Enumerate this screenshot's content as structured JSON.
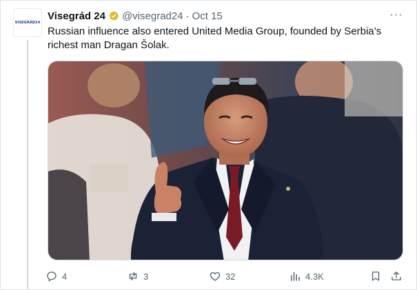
{
  "tweet": {
    "avatar_text": "VISEGRÁD24",
    "display_name": "Visegrád 24",
    "handle": "@visegrad24",
    "separator": "·",
    "date": "Oct 15",
    "more_label": "···",
    "text": "Russian influence also entered United Media Group, founded by Serbia’s richest man Dragan Šolak.",
    "verified_color": "#e8b825",
    "icons": {
      "verified": "verified-badge-icon",
      "more": "more-icon",
      "reply": "reply-icon",
      "retweet": "retweet-icon",
      "like": "like-icon",
      "views": "views-icon",
      "bookmark": "bookmark-icon",
      "share": "share-icon"
    }
  },
  "actions": {
    "replies": "4",
    "retweets": "3",
    "likes": "32",
    "views": "4.3K"
  },
  "colors": {
    "text": "#0f1419",
    "secondary": "#536471",
    "border": "#cfd9de"
  }
}
